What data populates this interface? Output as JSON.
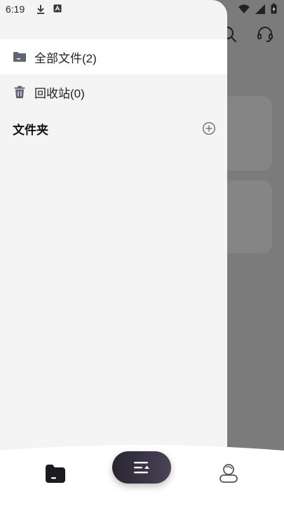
{
  "status_bar": {
    "time": "6:19"
  },
  "drawer": {
    "items": [
      {
        "label": "全部文件(2)",
        "selected": true
      },
      {
        "label": "回收站(0)",
        "selected": false
      }
    ],
    "section_title": "文件夹"
  },
  "colors": {
    "accent": "#2f2a38",
    "drawer_bg": "#f4f4f4",
    "selected_bg": "#ffffff",
    "scrim": "#7a7a7a"
  }
}
